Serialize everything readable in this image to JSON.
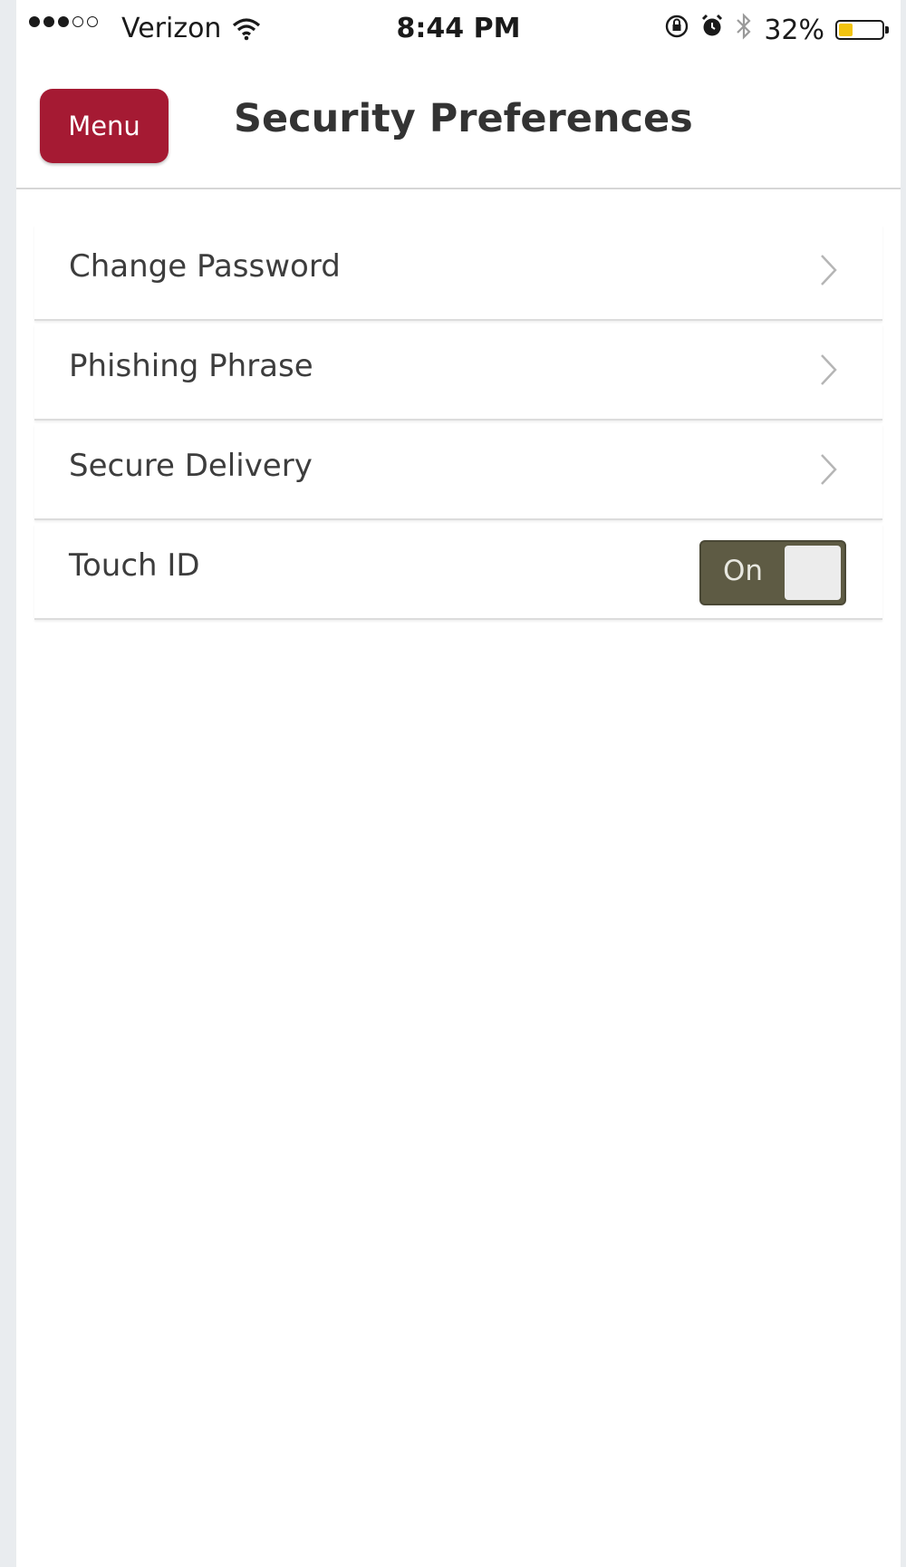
{
  "status_bar": {
    "carrier": "Verizon",
    "time": "8:44 PM",
    "battery_percent": "32%",
    "battery_level": 0.32,
    "signal_bars_filled": 3,
    "signal_bars_total": 5,
    "icons": [
      "wifi-icon",
      "orientation-lock-icon",
      "alarm-icon",
      "bluetooth-icon",
      "battery-icon"
    ]
  },
  "header": {
    "menu_label": "Menu",
    "title": "Security Preferences",
    "menu_color": "#a51a33"
  },
  "settings": {
    "items": [
      {
        "label": "Change Password",
        "icon": "chevron-right-icon"
      },
      {
        "label": "Phishing Phrase",
        "icon": "chevron-right-icon"
      },
      {
        "label": "Secure Delivery",
        "icon": "chevron-right-icon"
      },
      {
        "label": "Touch ID",
        "toggle_label": "On",
        "toggle_state": true,
        "toggle_color": "#5e5b44"
      }
    ]
  }
}
